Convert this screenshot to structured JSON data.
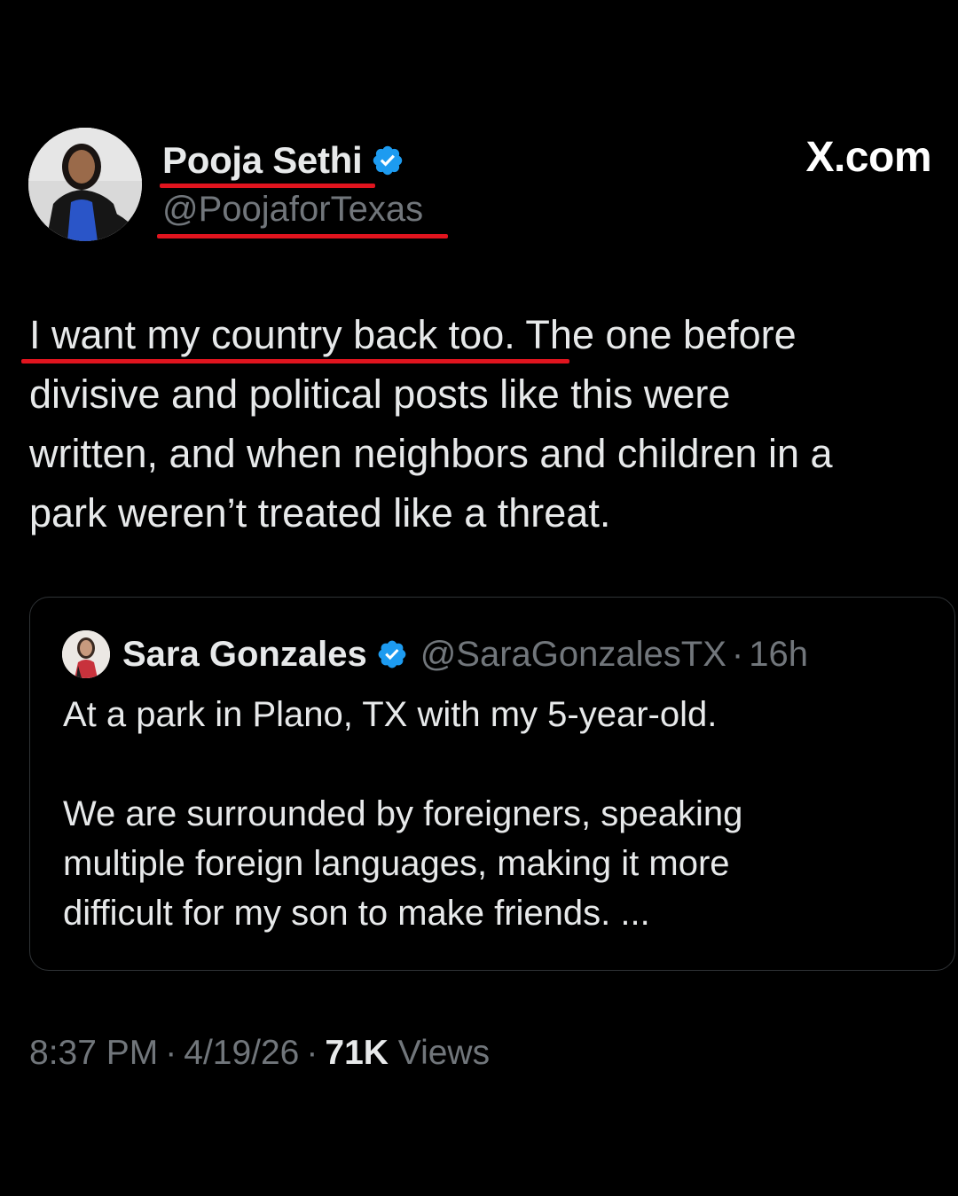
{
  "brand": {
    "label": "X.com"
  },
  "author": {
    "name": "Pooja Sethi",
    "handle": "@PoojaforTexas",
    "verified": true,
    "verified_color": "#1d9bf0"
  },
  "tweet": {
    "lines": [
      "I want my country back too. The one before",
      "divisive and political posts like this were",
      "written, and when neighbors and children in a",
      "park weren’t treated like a threat."
    ]
  },
  "quote": {
    "name": "Sara Gonzales",
    "handle": "@SaraGonzalesTX",
    "separator": "·",
    "time": "16h",
    "verified": true,
    "paragraph1": [
      "At a park in Plano, TX with my 5-year-old."
    ],
    "paragraph2": [
      "We are surrounded by foreigners, speaking",
      "multiple foreign languages, making it more",
      "difficult for my son to make friends. ..."
    ]
  },
  "meta": {
    "time": "8:37 PM",
    "date": "4/19/26",
    "views_count": "71K",
    "views_label": "Views",
    "separator": "·"
  },
  "colors": {
    "background": "#000000",
    "text": "#e7e9ea",
    "secondary_text": "#71767b",
    "highlight_underline": "#e0141e",
    "card_border": "#2f3336"
  }
}
